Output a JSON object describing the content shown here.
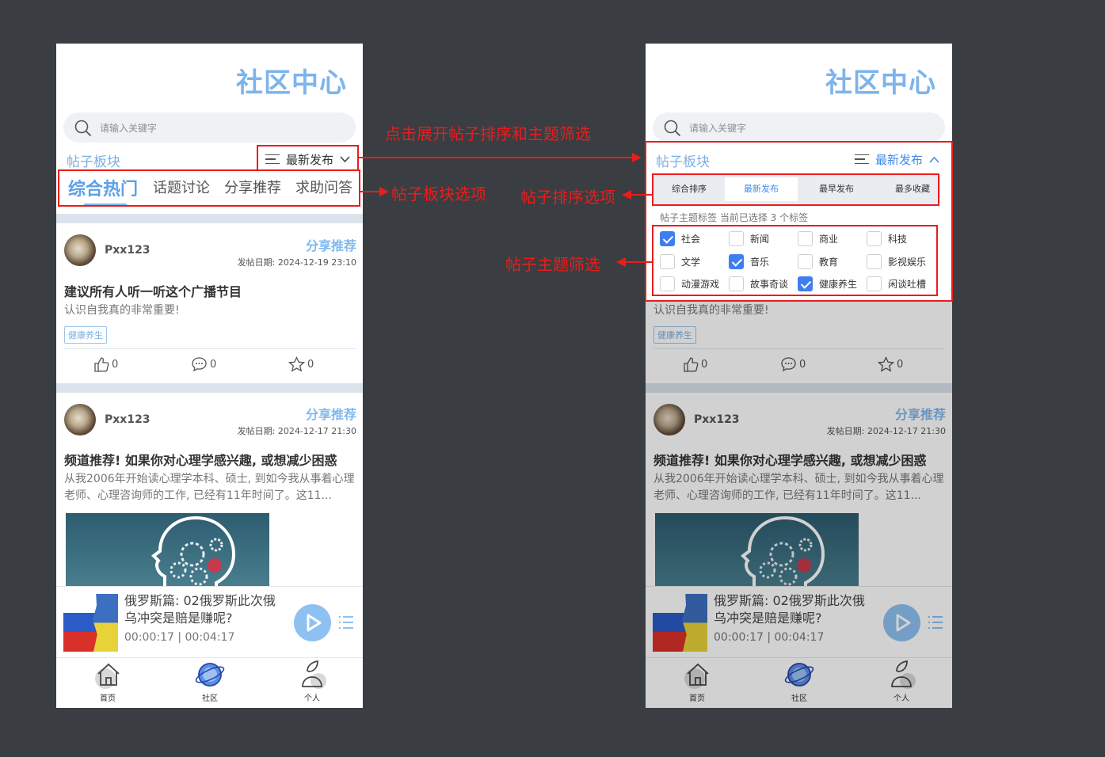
{
  "app": {
    "title": "社区中心",
    "search_placeholder": "请输入关键字"
  },
  "section": {
    "label": "帖子板块",
    "sort_current": "最新发布"
  },
  "tabs": [
    "综合热门",
    "话题讨论",
    "分享推荐",
    "求助问答"
  ],
  "posts": [
    {
      "user": "Pxx123",
      "category": "分享推荐",
      "date": "发帖日期: 2024-12-19 23:10",
      "title": "建议所有人听一听这个广播节目",
      "excerpt": "认识自我真的非常重要!",
      "tag": "健康养生",
      "likes": "0",
      "comments": "0",
      "favorites": "0"
    },
    {
      "user": "Pxx123",
      "category": "分享推荐",
      "date": "发帖日期: 2024-12-17 21:30",
      "title": "频道推荐! 如果你对心理学感兴趣, 或想减少困惑",
      "excerpt": "从我2006年开始读心理学本科、硕士, 到如今我从事着心理老师、心理咨询师的工作, 已经有11年时间了。这11..."
    }
  ],
  "player": {
    "track_line1": "俄罗斯篇: 02俄罗斯此次俄",
    "track_line2": "乌冲突是赔是赚呢?",
    "time": "00:00:17 | 00:04:17"
  },
  "tabbar": [
    {
      "label": "首页",
      "icon": "home-icon"
    },
    {
      "label": "社区",
      "icon": "planet-icon"
    },
    {
      "label": "个人",
      "icon": "person-icon"
    }
  ],
  "sort_options": [
    {
      "label": "综合排序",
      "active": false
    },
    {
      "label": "最新发布",
      "active": true
    },
    {
      "label": "最早发布",
      "active": false
    },
    {
      "label": "最多收藏",
      "active": false
    }
  ],
  "topic_info": "帖子主题标签 当前已选择 3 个标签",
  "topics": [
    {
      "label": "社会",
      "checked": true
    },
    {
      "label": "新闻",
      "checked": false
    },
    {
      "label": "商业",
      "checked": false
    },
    {
      "label": "科技",
      "checked": false
    },
    {
      "label": "文学",
      "checked": false
    },
    {
      "label": "音乐",
      "checked": true
    },
    {
      "label": "教育",
      "checked": false
    },
    {
      "label": "影视娱乐",
      "checked": false
    },
    {
      "label": "动漫游戏",
      "checked": false
    },
    {
      "label": "故事奇谈",
      "checked": false
    },
    {
      "label": "健康养生",
      "checked": true
    },
    {
      "label": "闲谈吐槽",
      "checked": false
    }
  ],
  "annotations": {
    "expand": "点击展开帖子排序和主题筛选",
    "tabs": "帖子板块选项",
    "sort": "帖子排序选项",
    "topic": "帖子主题筛选"
  },
  "colors": {
    "accent": "#7db4ec",
    "annotation": "#ec1c1c",
    "checked": "#3e7ef0",
    "background": "#3a3d41"
  }
}
